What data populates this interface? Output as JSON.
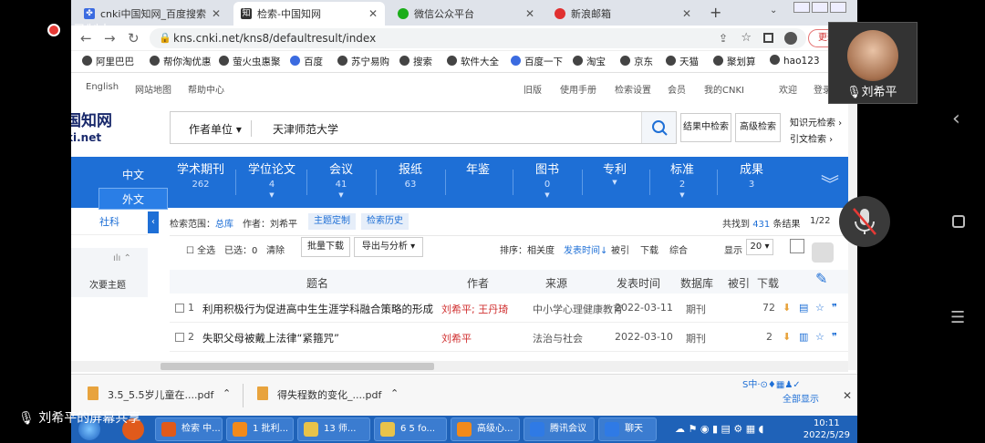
{
  "overlay": {
    "recording_label": "录制中",
    "camera_name": "刘希平",
    "share_label": "刘希平的屏幕共享"
  },
  "tabs": [
    {
      "label": "cnki中国知网_百度搜索",
      "icon_color": "#3b6be0"
    },
    {
      "label": "检索-中国知网",
      "icon_color": "#333333"
    },
    {
      "label": "微信公众平台",
      "icon_color": "#1aad19"
    },
    {
      "label": "新浪邮箱",
      "icon_color": "#e03030"
    }
  ],
  "address": {
    "url": "kns.cnki.net/kns8/defaultresult/index",
    "update_label": "更新"
  },
  "bookmarks": [
    "阿里巴巴",
    "帮你淘优惠",
    "萤火虫惠聚",
    "百度",
    "苏宁易购",
    "搜索",
    "软件大全",
    "百度一下",
    "淘宝",
    "京东",
    "天猫",
    "聚划算",
    "hao123"
  ],
  "topnav": {
    "left": [
      "English",
      "网站地图",
      "帮助中心"
    ],
    "right": [
      "旧版",
      "使用手册",
      "检索设置",
      "会员",
      "我的CNKI",
      "欢迎",
      "登录"
    ]
  },
  "logo": {
    "text": "国知网",
    "sub": "ki.net"
  },
  "search": {
    "field": "作者单位",
    "value": "天津师范大学",
    "in_result": "结果中检索",
    "advanced": "高级检索",
    "knowledge": "知识元检索",
    "citation": "引文检索"
  },
  "lang": {
    "cn": "中文",
    "en": "外文"
  },
  "categories": [
    {
      "name": "学术期刊",
      "count": "262"
    },
    {
      "name": "学位论文",
      "count": "4"
    },
    {
      "name": "会议",
      "count": "41"
    },
    {
      "name": "报纸",
      "count": "63"
    },
    {
      "name": "年鉴",
      "count": ""
    },
    {
      "name": "图书",
      "count": "0"
    },
    {
      "name": "专利",
      "count": ""
    },
    {
      "name": "标准",
      "count": "2"
    },
    {
      "name": "成果",
      "count": "3"
    }
  ],
  "left": {
    "sheke": "社科",
    "subject": "次要主题"
  },
  "results": {
    "scope_label": "检索范围：",
    "scope_value": "总库",
    "author_label": "作者：刘希平",
    "chip_theme": "主题定制",
    "chip_history": "检索历史",
    "found_prefix": "共找到",
    "found_count": "431",
    "found_suffix": "条结果",
    "page": "1/22"
  },
  "toolbar": {
    "select_all": "全选",
    "selected": "已选：",
    "selected_count": "0",
    "clear": "清除",
    "batch_download": "批量下载",
    "export": "导出与分析",
    "sort_label": "排序：",
    "sort_relevance": "相关度",
    "sort_date": "发表时间",
    "sort_cited": "被引",
    "sort_download": "下载",
    "sort_comprehensive": "综合",
    "display_label": "显示",
    "display_value": "20"
  },
  "table": {
    "headers": [
      "题名",
      "作者",
      "来源",
      "发表时间",
      "数据库",
      "被引",
      "下载"
    ],
    "rows": [
      {
        "num": "1",
        "title": "利用积极行为促进高中生生涯学科融合策略的形成",
        "authors": "刘希平; 王丹琦",
        "source": "中小学心理健康教育",
        "date": "2022-03-11",
        "db": "期刊",
        "cited": "",
        "downloads": "72"
      },
      {
        "num": "2",
        "title": "失职父母被戴上法律“紧箍咒”",
        "authors": "刘希平",
        "source": "法治与社会",
        "date": "2022-03-10",
        "db": "期刊",
        "cited": "",
        "downloads": "2"
      }
    ]
  },
  "downloads": [
    {
      "name": "3.5_5.5岁儿童在....pdf"
    },
    {
      "name": "得失程数的变化_....pdf"
    }
  ],
  "download_show_all": "全部显示",
  "taskbar": [
    {
      "label": "检索 中...",
      "color": "#e05a1b"
    },
    {
      "label": "1  批利...",
      "color": "#f28a1b"
    },
    {
      "label": "13  师...",
      "color": "#e8c34a"
    },
    {
      "label": "6  5 fo...",
      "color": "#e8c34a"
    },
    {
      "label": "高级心...",
      "color": "#f28a1b"
    },
    {
      "label": "腾讯会议",
      "color": "#2f7ae5"
    },
    {
      "label": "聊天",
      "color": "#2f7ae5"
    }
  ],
  "clock": {
    "time": "10:11",
    "date": "2022/5/29"
  }
}
